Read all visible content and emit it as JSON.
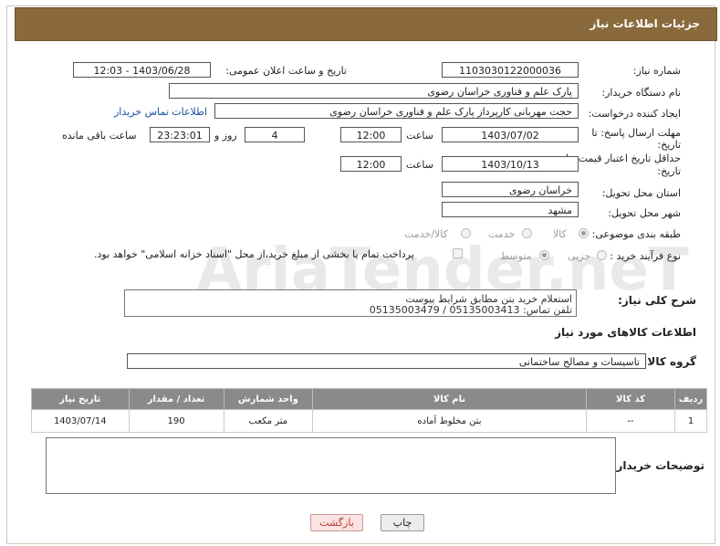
{
  "header": {
    "title": "جزئیات اطلاعات نیاز"
  },
  "fields": {
    "need_number_label": "شماره نیاز:",
    "need_number": "1103030122000036",
    "announce_label": "تاریخ و ساعت اعلان عمومی:",
    "announce_value": "1403/06/28 - 12:03",
    "buyer_org_label": "نام دستگاه خریدار:",
    "buyer_org": "پارک علم و فناوری خراسان رضوی",
    "creator_label": "ایجاد کننده درخواست:",
    "creator": "حجت مهربانی کارپرداز پارک علم و فناوری خراسان رضوی",
    "contact_link": "اطلاعات تماس خریدار",
    "deadline_label_1": "مهلت ارسال پاسخ: تا",
    "deadline_label_2": "تاریخ:",
    "deadline_date": "1403/07/02",
    "time_label": "ساعت",
    "deadline_time": "12:00",
    "days_value": "4",
    "days_label": "روز و",
    "remaining_time": "23:23:01",
    "remaining_label": "ساعت باقی مانده",
    "validity_label_1": "حداقل تاریخ اعتبار قیمت: تا",
    "validity_label_2": "تاریخ:",
    "validity_date": "1403/10/13",
    "validity_time": "12:00",
    "province_label": "استان محل تحویل:",
    "province": "خراسان رضوی",
    "city_label": "شهر محل تحویل:",
    "city": "مشهد",
    "category_label": "طبقه بندی موضوعی:",
    "category_opt_goods": "کالا",
    "category_opt_service": "خدمت",
    "category_opt_both": "کالا/خدمت",
    "process_label": "نوع فرآیند خرید :",
    "process_opt_partial": "جزیی",
    "process_opt_medium": "متوسط",
    "payment_note": "پرداخت تمام یا بخشی از مبلغ خرید،از محل \"اسناد خزانه اسلامی\" خواهد بود."
  },
  "description": {
    "label": "شرح کلی نیاز:",
    "line1": "استعلام خرید بتن مطابق شرایط پیوست",
    "line2": "تلفن تماس: 05135003413 / 05135003479"
  },
  "goods": {
    "section_title": "اطلاعات کالاهای مورد نیاز",
    "group_label": "گروه کالا:",
    "group_value": "تاسیسات و مصالح ساختمانی",
    "columns": [
      "ردیف",
      "کد کالا",
      "نام کالا",
      "واحد شمارش",
      "تعداد / مقدار",
      "تاریخ نیاز"
    ],
    "rows": [
      [
        "1",
        "--",
        "بتن مخلوط آماده",
        "متر مکعب",
        "190",
        "1403/07/14"
      ]
    ]
  },
  "notes": {
    "label": "توضیحات خریدار:"
  },
  "buttons": {
    "print": "چاپ",
    "back": "بازگشت"
  },
  "watermark": {
    "text": "AriaTender.neT"
  }
}
